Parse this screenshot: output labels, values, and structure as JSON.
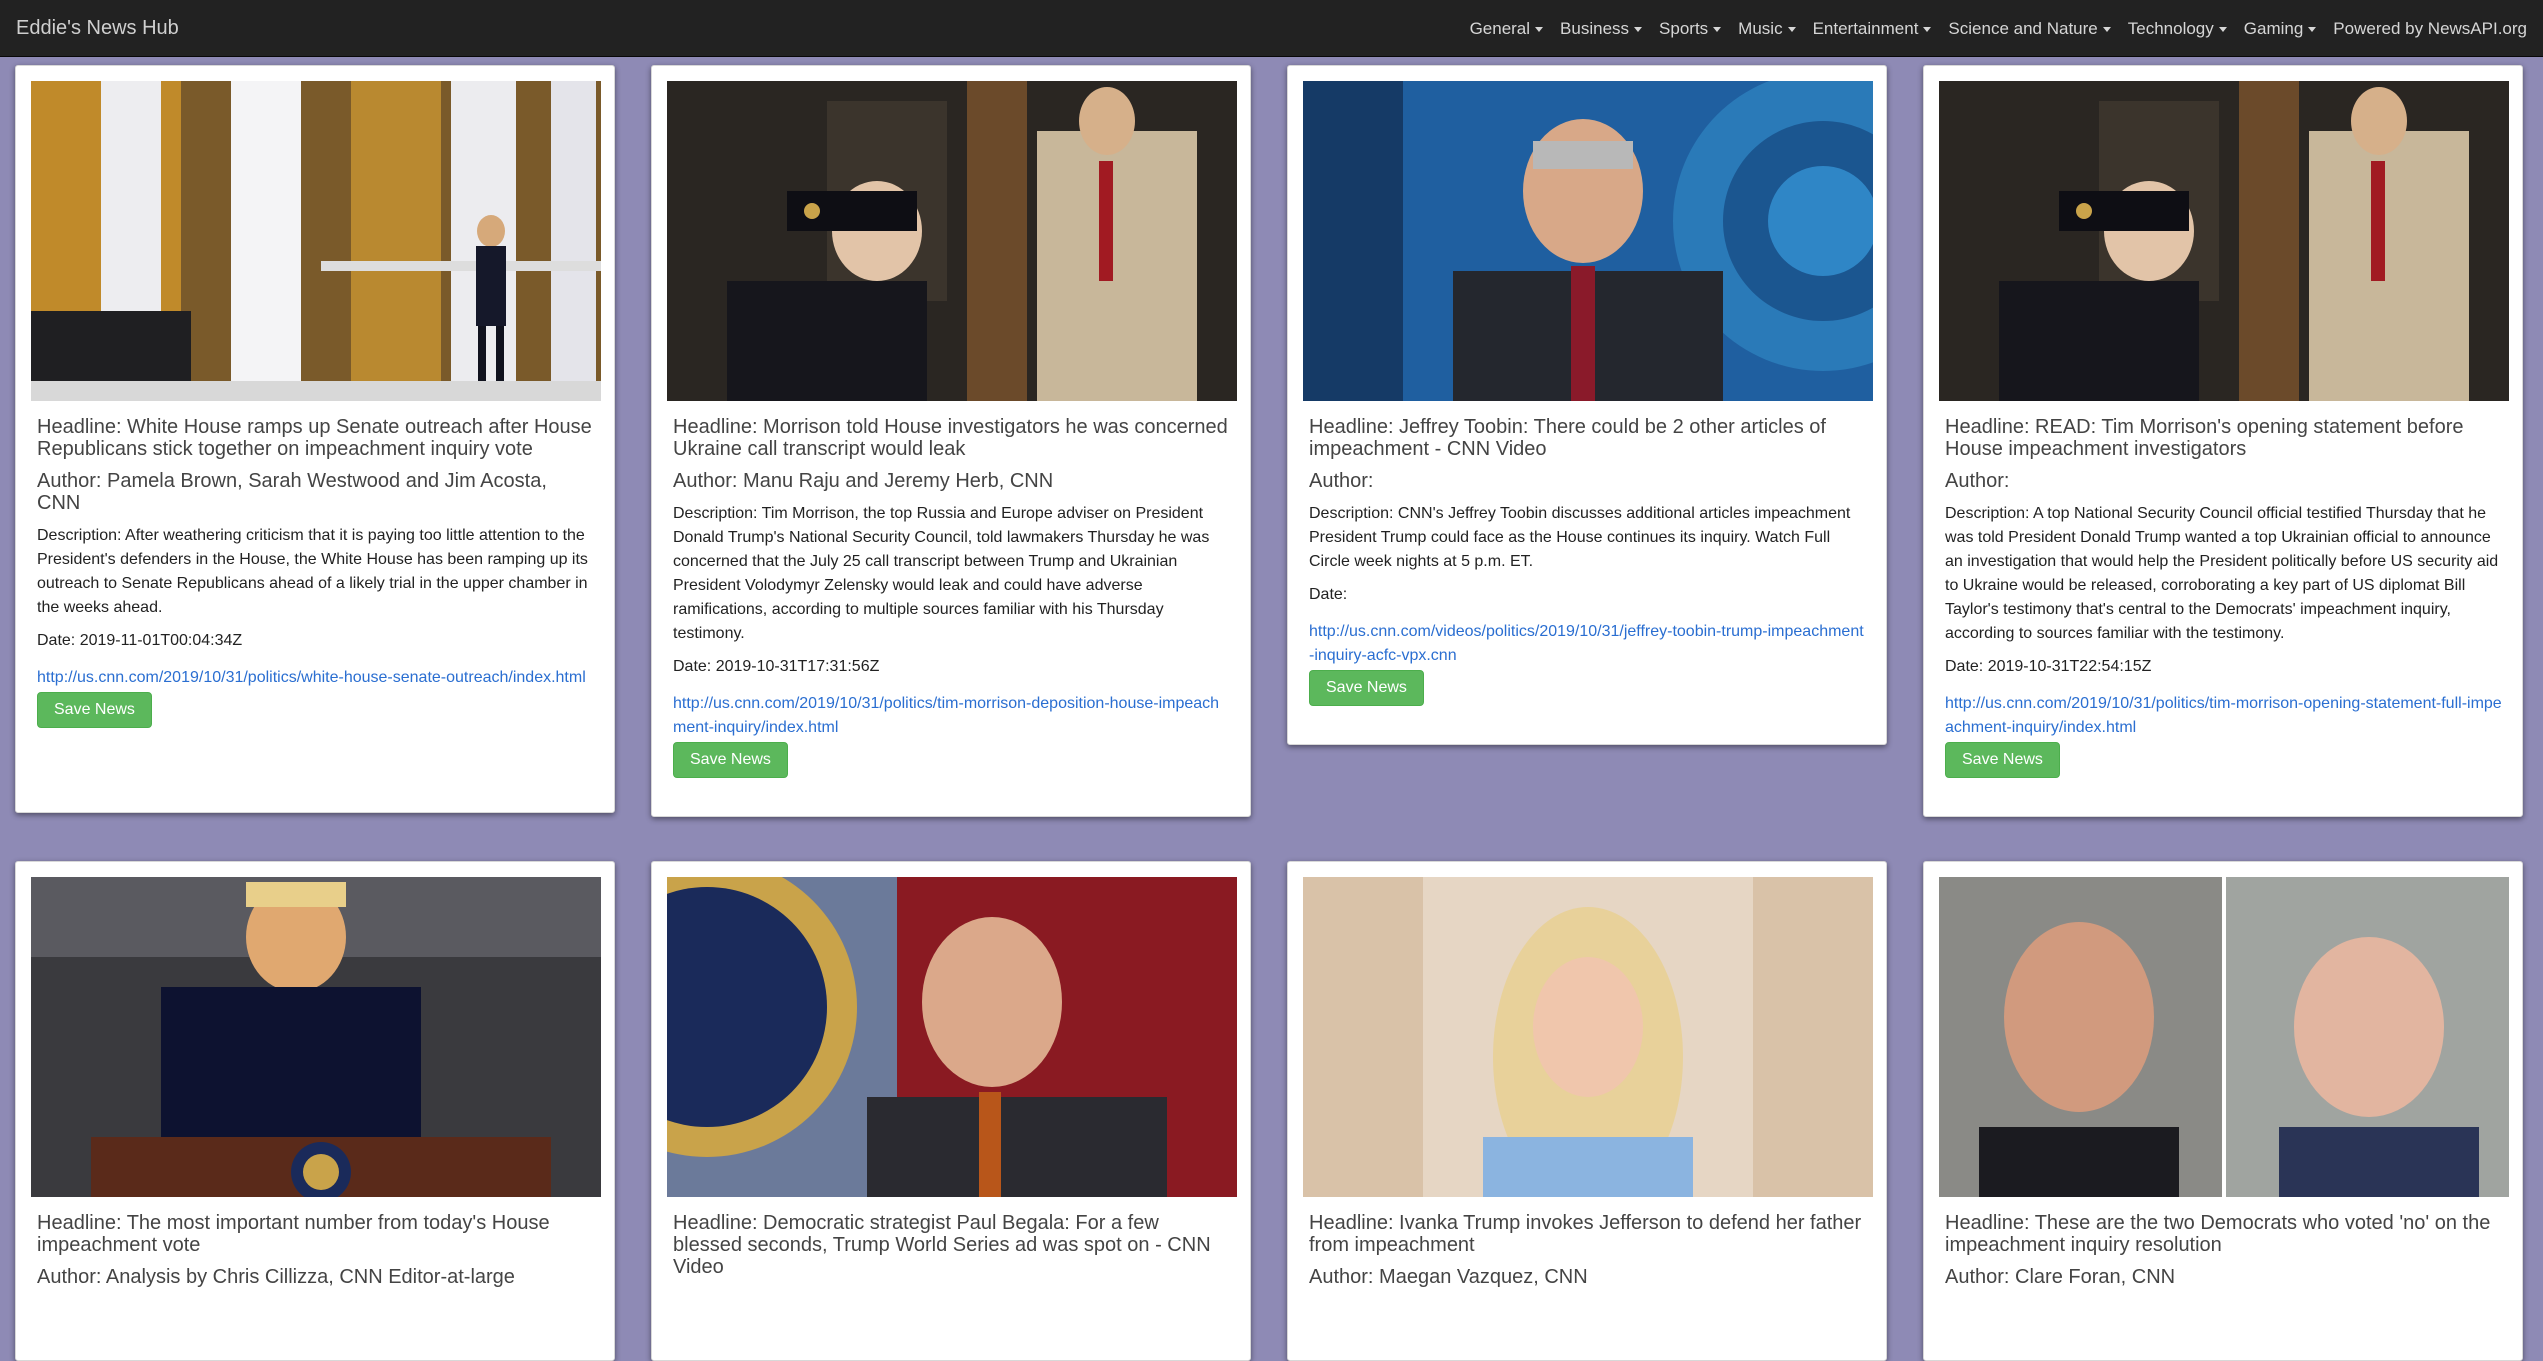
{
  "app": {
    "brand": "Eddie's News Hub",
    "nav": [
      "General",
      "Business",
      "Sports",
      "Music",
      "Entertainment",
      "Science and Nature",
      "Technology",
      "Gaming"
    ],
    "powered_by": "Powered by NewsAPI.org"
  },
  "save_label": "Save News",
  "cards": [
    {
      "headline": "Headline: White House ramps up Senate outreach after House Republicans stick together on impeachment inquiry vote",
      "author": "Author: Pamela Brown, Sarah Westwood and Jim Acosta, CNN",
      "description": "Description: After weathering criticism that it is paying too little attention to the President's defenders in the House, the White House has been ramping up its outreach to Senate Republicans ahead of a likely trial in the upper chamber in the weeks ahead.",
      "date": "Date: 2019-11-01T00:04:34Z",
      "url": "http://us.cnn.com/2019/10/31/politics/white-house-senate-outreach/index.html"
    },
    {
      "headline": "Headline: Morrison told House investigators he was concerned Ukraine call transcript would leak",
      "author": "Author: Manu Raju and Jeremy Herb, CNN",
      "description": "Description: Tim Morrison, the top Russia and Europe adviser on President Donald Trump's National Security Council, told lawmakers Thursday he was concerned that the July 25 call transcript between Trump and Ukrainian President Volodymyr Zelensky would leak and could have adverse ramifications, according to multiple sources familiar with his Thursday testimony.",
      "date": "Date: 2019-10-31T17:31:56Z",
      "url": "http://us.cnn.com/2019/10/31/politics/tim-morrison-deposition-house-impeachment-inquiry/index.html"
    },
    {
      "headline": "Headline: Jeffrey Toobin: There could be 2 other articles of impeachment - CNN Video",
      "author": "Author:",
      "description": "Description: CNN's Jeffrey Toobin discusses additional articles impeachment President Trump could face as the House continues its inquiry. Watch Full Circle week nights at 5 p.m. ET.",
      "date": "Date:",
      "url": "http://us.cnn.com/videos/politics/2019/10/31/jeffrey-toobin-trump-impeachment-inquiry-acfc-vpx.cnn"
    },
    {
      "headline": "Headline: READ: Tim Morrison's opening statement before House impeachment investigators",
      "author": "Author:",
      "description": "Description: A top National Security Council official testified Thursday that he was told President Donald Trump wanted a top Ukrainian official to announce an investigation that would help the President politically before US security aid to Ukraine would be released, corroborating a key part of US diplomat Bill Taylor's testimony that's central to the Democrats' impeachment inquiry, according to sources familiar with the testimony.",
      "date": "Date: 2019-10-31T22:54:15Z",
      "url": "http://us.cnn.com/2019/10/31/politics/tim-morrison-opening-statement-full-impeachment-inquiry/index.html"
    },
    {
      "headline": "Headline: The most important number from today's House impeachment vote",
      "author": "Author: Analysis by Chris Cillizza, CNN Editor-at-large",
      "description": "",
      "date": "",
      "url": ""
    },
    {
      "headline": "Headline: Democratic strategist Paul Begala: For a few blessed seconds, Trump World Series ad was spot on - CNN Video",
      "author": "",
      "description": "",
      "date": "",
      "url": ""
    },
    {
      "headline": "Headline: Ivanka Trump invokes Jefferson to defend her father from impeachment",
      "author": "Author: Maegan Vazquez, CNN",
      "description": "",
      "date": "",
      "url": ""
    },
    {
      "headline": "Headline: These are the two Democrats who voted 'no' on the impeachment inquiry resolution",
      "author": "Author: Clare Foran, CNN",
      "description": "",
      "date": "",
      "url": ""
    }
  ]
}
